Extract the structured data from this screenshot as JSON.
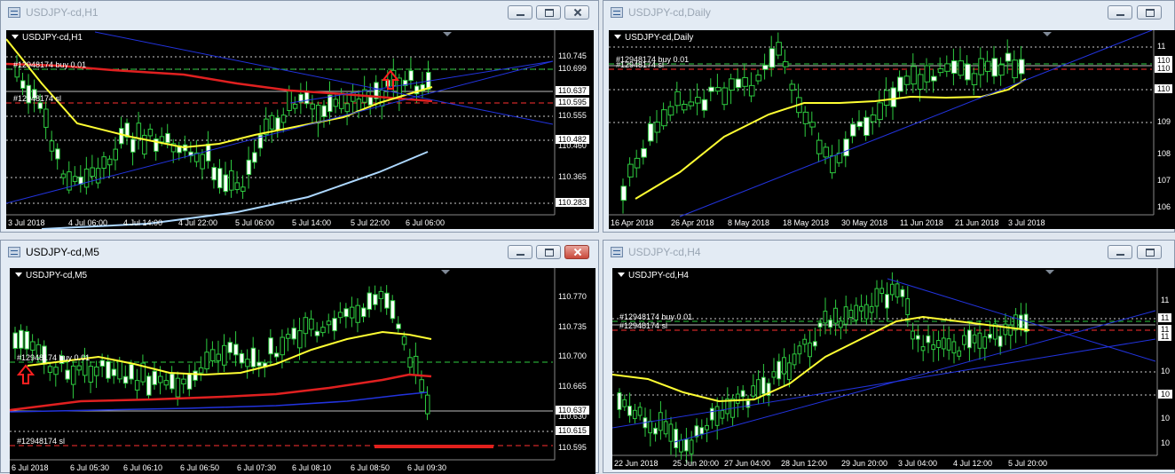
{
  "windows": [
    {
      "title": "USDJPY-cd,H1",
      "symbol": "USDJPY-cd,H1",
      "active": false,
      "orders": [
        "#12948174 buy 0.01",
        "#12948174 sl"
      ],
      "prices": [
        "110.745",
        "110.699",
        "110.637",
        "110.595",
        "110.555",
        "110.482",
        "110.460",
        "110.365",
        "110.283"
      ],
      "highlighted": [
        "110.637",
        "110.595",
        "110.482",
        "110.283"
      ],
      "times": [
        "3 Jul 2018",
        "4 Jul 06:00",
        "4 Jul 14:00",
        "4 Jul 22:00",
        "5 Jul 06:00",
        "5 Jul 14:00",
        "5 Jul 22:00",
        "6 Jul 06:00"
      ]
    },
    {
      "title": "USDJPY-cd,Daily",
      "symbol": "USDJPY-cd,Daily",
      "active": false,
      "orders": [
        "#12948174 buy 0.01",
        "#12948174 sl"
      ],
      "prices": [
        "11",
        "110",
        "110",
        "110",
        "109",
        "108",
        "107",
        "106"
      ],
      "highlighted": [
        "110"
      ],
      "times": [
        "16 Apr 2018",
        "26 Apr 2018",
        "8 May 2018",
        "18 May 2018",
        "30 May 2018",
        "11 Jun 2018",
        "21 Jun 2018",
        "3 Jul 2018"
      ]
    },
    {
      "title": "USDJPY-cd,M5",
      "symbol": "USDJPY-cd,M5",
      "active": true,
      "orders": [
        "#12948174 buy 0.01",
        "#12948174 sl"
      ],
      "prices": [
        "110.770",
        "110.735",
        "110.700",
        "110.665",
        "110.637",
        "110.630",
        "110.615",
        "110.595"
      ],
      "highlighted": [
        "110.637",
        "110.615"
      ],
      "times": [
        "6 Jul 2018",
        "6 Jul 05:30",
        "6 Jul 06:10",
        "6 Jul 06:50",
        "6 Jul 07:30",
        "6 Jul 08:10",
        "6 Jul 08:50",
        "6 Jul 09:30"
      ]
    },
    {
      "title": "USDJPY-cd,H4",
      "symbol": "USDJPY-cd,H4",
      "active": false,
      "orders": [
        "#12948174 buy 0.01",
        "#12948174 sl"
      ],
      "prices": [
        "11",
        "11",
        "11",
        "11",
        "10",
        "10",
        "10",
        "10"
      ],
      "highlighted": [
        "11",
        "10"
      ],
      "times": [
        "22 Jun 2018",
        "25 Jun 20:00",
        "27 Jun 04:00",
        "28 Jun 12:00",
        "29 Jun 20:00",
        "3 Jul 04:00",
        "4 Jul 12:00",
        "5 Jul 20:00"
      ]
    }
  ],
  "colors": {
    "chart_bg": "#000000",
    "candle": "#2ecc40",
    "ma_fast": "#ffff33",
    "ma_slow": "#e02020",
    "ma_long": "#add8ff",
    "trendline": "#2233dd",
    "sl_line": "#ff3030",
    "buy_line": "#2ecc40",
    "close_button": "#c9483a"
  }
}
